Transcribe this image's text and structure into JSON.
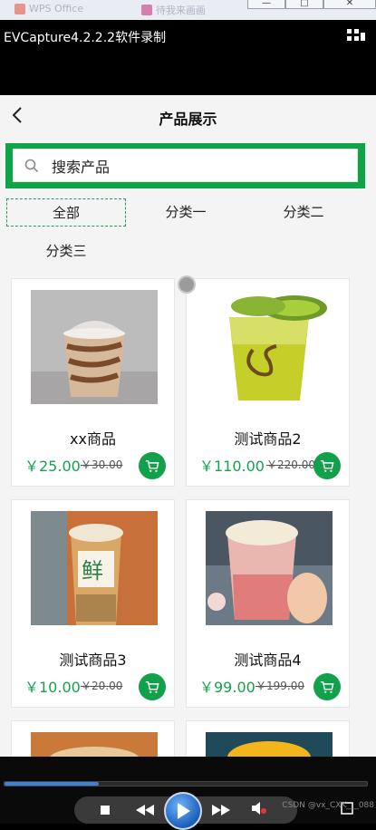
{
  "window": {
    "recorder_title": "EVCapture4.2.2.2软件录制",
    "taskbar_item_1": "WPS Office",
    "taskbar_item_2": "待我来画画",
    "minimize_label": "—",
    "maximize_label": "□",
    "close_label": "✕"
  },
  "app": {
    "page_title": "产品展示",
    "search": {
      "placeholder": "搜索产品"
    },
    "tabs": [
      "全部",
      "分类一",
      "分类二",
      "分类三"
    ],
    "active_tab": "全部",
    "products": [
      {
        "name": "xx商品",
        "price": "￥25.00",
        "original_price": "￥30.00",
        "image": "iced-coffee-cup"
      },
      {
        "name": "测试商品2",
        "price": "￥110.00",
        "original_price": "￥220.00",
        "image": "kiwi-tea-cup"
      },
      {
        "name": "测试商品3",
        "price": "￥10.00",
        "original_price": "￥20.00",
        "image": "milk-tea-cup"
      },
      {
        "name": "测试商品4",
        "price": "￥99.00",
        "original_price": "￥199.00",
        "image": "strawberry-drink-cup"
      }
    ],
    "colors": {
      "accent": "#12a14b",
      "search_border": "#0fa34a",
      "price": "#17a14e"
    }
  },
  "player": {
    "progress": 0.26,
    "watermark": "CSDN @vx_CXK___088"
  }
}
